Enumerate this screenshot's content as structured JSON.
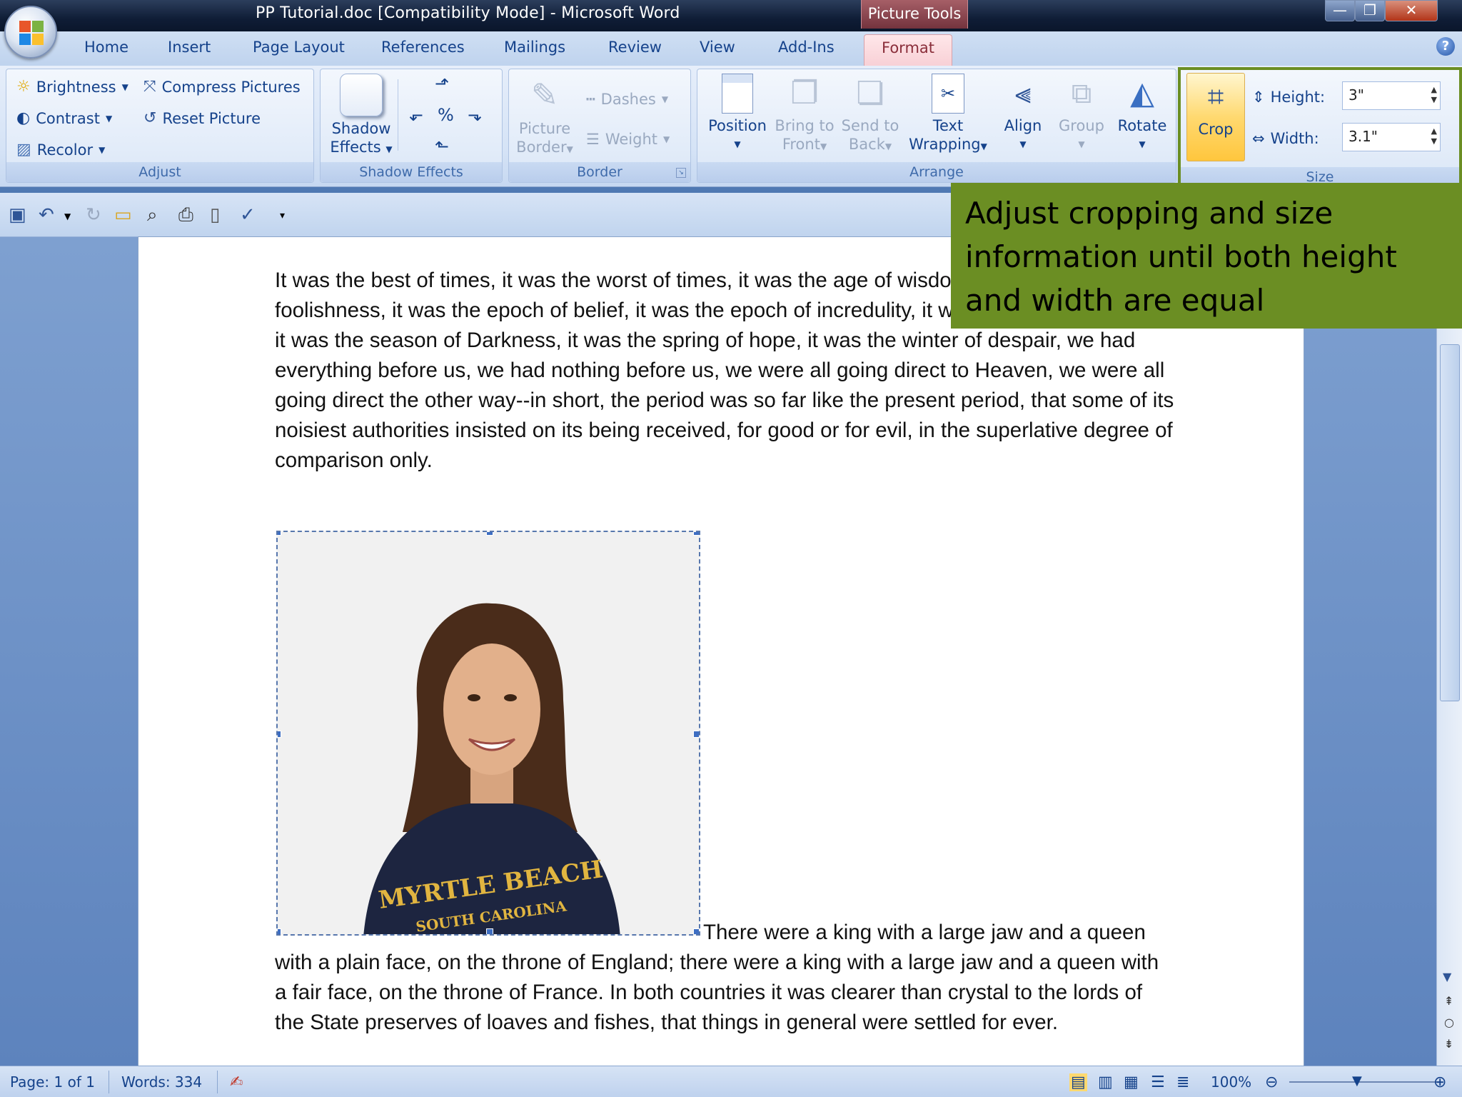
{
  "window": {
    "title": "PP Tutorial.doc [Compatibility Mode] - Microsoft Word",
    "context_tab": "Picture Tools",
    "minimize": "—",
    "maximize": "❐",
    "close": "✕"
  },
  "tabs": [
    "Home",
    "Insert",
    "Page Layout",
    "References",
    "Mailings",
    "Review",
    "View",
    "Add-Ins",
    "Format"
  ],
  "help": "?",
  "ribbon": {
    "adjust": {
      "label": "Adjust",
      "brightness": "Brightness",
      "contrast": "Contrast",
      "recolor": "Recolor",
      "compress": "Compress Pictures",
      "reset": "Reset Picture"
    },
    "shadow": {
      "label": "Shadow Effects",
      "button_line1": "Shadow",
      "button_line2": "Effects"
    },
    "border": {
      "label": "Border",
      "picture_border_line1": "Picture",
      "picture_border_line2": "Border",
      "dashes": "Dashes",
      "weight": "Weight"
    },
    "arrange": {
      "label": "Arrange",
      "position": "Position",
      "bring_front_line1": "Bring to",
      "bring_front_line2": "Front",
      "send_back_line1": "Send to",
      "send_back_line2": "Back",
      "text_wrap_line1": "Text",
      "text_wrap_line2": "Wrapping",
      "align": "Align",
      "group": "Group",
      "rotate": "Rotate"
    },
    "size": {
      "label": "Size",
      "crop": "Crop",
      "height_label": "Height:",
      "height_value": "3\"",
      "width_label": "Width:",
      "width_value": "3.1\""
    }
  },
  "document": {
    "paragraph1": "It was the best of times, it was the worst of times, it was the age of wisdom, it was the age of foolishness, it was the epoch of belief, it was the epoch of incredulity, it was the season of Light, it was the season of Darkness, it was the spring of hope, it was the winter of despair, we had everything before us, we had nothing before us, we were all going direct to Heaven, we were all going direct the other way--in short, the period was so far like the present period, that some of its noisiest authorities insisted on its being received, for good or for evil, in the superlative degree of comparison only.",
    "paragraph2": "There were a king with a large jaw and a queen with a plain face, on the throne of England; there were a king with a large jaw and a queen with a fair face, on the throne of France. In both countries it was clearer than crystal to the lords of the State preserves of loaves and fishes, that things in general were settled for ever.",
    "shirt_text_line1": "MYRTLE BEACH",
    "shirt_text_line2": "SOUTH CAROLINA"
  },
  "status": {
    "page": "Page: 1 of 1",
    "words": "Words: 334",
    "zoom": "100%"
  },
  "callout": {
    "text": "Adjust cropping and size information until both height and width are equal"
  },
  "colors": {
    "callout_bg": "#6b8e23",
    "format_tab": "#f8d0d6",
    "ribbon_text": "#15428b"
  }
}
